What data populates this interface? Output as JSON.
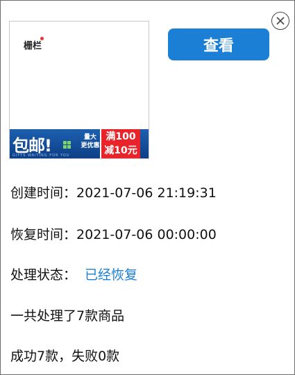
{
  "dialog": {
    "close_icon": "close-circle-icon"
  },
  "thumbnail": {
    "label": "栅栏",
    "banner_main": "包邮!",
    "banner_sub_line1": "量大",
    "banner_sub_line2": "更优惠",
    "banner_small": "GIFTS WAITING FOR YOU",
    "promo_line1": "满100",
    "promo_line2": "减10元"
  },
  "actions": {
    "view_label": "查看"
  },
  "info": {
    "created_label": "创建时间：",
    "created_value": "2021-07-06 21:19:31",
    "restored_label": "恢复时间：",
    "restored_value": "2021-07-06 00:00:00",
    "status_label": "处理状态：",
    "status_value": "已经恢复",
    "total_text": "一共处理了7款商品",
    "result_text": "成功7款，失败0款"
  },
  "colors": {
    "accent": "#1b7fd6",
    "promo_red": "#e8232a",
    "banner_blue": "#1d5fb0"
  }
}
